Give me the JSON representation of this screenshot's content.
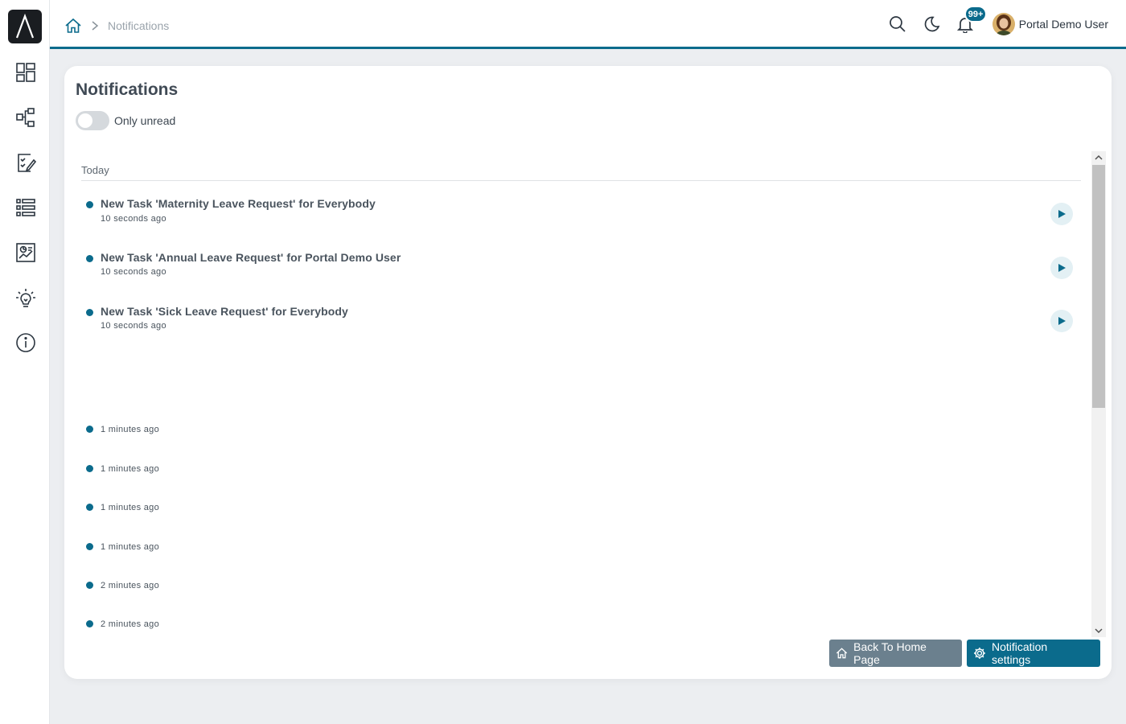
{
  "app": {
    "logo_icon": "logo-caret-icon"
  },
  "sidebar": {
    "items": [
      {
        "icon": "dashboard-icon"
      },
      {
        "icon": "workflow-icon"
      },
      {
        "icon": "task-edit-icon"
      },
      {
        "icon": "list-icon"
      },
      {
        "icon": "report-icon"
      },
      {
        "icon": "lightbulb-icon"
      },
      {
        "icon": "info-icon"
      }
    ]
  },
  "header": {
    "breadcrumb": {
      "home_icon": "home-icon",
      "current": "Notifications"
    },
    "notification_badge": "99+",
    "user_name": "Portal Demo User"
  },
  "page": {
    "title": "Notifications",
    "toggle_label": "Only unread",
    "section_label": "Today"
  },
  "notifications": [
    {
      "title": "New Task 'Maternity Leave Request' for Everybody",
      "time": "10 seconds ago"
    },
    {
      "title": "New Task 'Annual Leave Request' for Portal Demo User",
      "time": "10 seconds ago"
    },
    {
      "title": "New Task 'Sick Leave Request' for Everybody",
      "time": "10 seconds ago"
    },
    {
      "title": "",
      "time": "1 minutes ago"
    },
    {
      "title": "",
      "time": "1 minutes ago"
    },
    {
      "title": "",
      "time": "1 minutes ago"
    },
    {
      "title": "",
      "time": "1 minutes ago"
    },
    {
      "title": "",
      "time": "2 minutes ago"
    },
    {
      "title": "",
      "time": "2 minutes ago"
    },
    {
      "title": "",
      "time": "2 minutes ago"
    },
    {
      "title": "",
      "time": "2 minutes ago"
    }
  ],
  "buttons": {
    "back_home": "Back To Home Page",
    "notification_settings": "Notification settings"
  },
  "colors": {
    "accent": "#0b6b8c",
    "secondary_button": "#6b808e",
    "background": "#eceef1"
  }
}
